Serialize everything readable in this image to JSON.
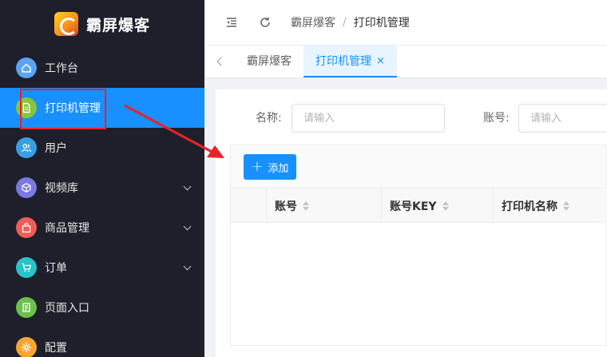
{
  "app": {
    "title": "霸屏爆客"
  },
  "sidebar": {
    "items": [
      {
        "label": "工作台",
        "icon": "home-icon",
        "color": "#5aa3f5",
        "active": false,
        "expandable": false
      },
      {
        "label": "打印机管理",
        "icon": "document-icon",
        "color": "#87c63a",
        "active": true,
        "expandable": false
      },
      {
        "label": "用户",
        "icon": "users-icon",
        "color": "#3a9fe2",
        "active": false,
        "expandable": false
      },
      {
        "label": "视频库",
        "icon": "cube-icon",
        "color": "#7b78e0",
        "active": false,
        "expandable": true
      },
      {
        "label": "商品管理",
        "icon": "bag-icon",
        "color": "#f05d58",
        "active": false,
        "expandable": true
      },
      {
        "label": "订单",
        "icon": "cart-icon",
        "color": "#26c3c7",
        "active": false,
        "expandable": true
      },
      {
        "label": "页面入口",
        "icon": "entry-icon",
        "color": "#6cc04a",
        "active": false,
        "expandable": false
      },
      {
        "label": "配置",
        "icon": "gear-icon",
        "color": "#f7a531",
        "active": false,
        "expandable": false
      }
    ]
  },
  "header": {
    "breadcrumb": [
      "霸屏爆客",
      "打印机管理"
    ],
    "separator": "/"
  },
  "tabs": [
    {
      "label": "霸屏爆客",
      "active": false,
      "closable": false
    },
    {
      "label": "打印机管理",
      "active": true,
      "closable": true,
      "close_glyph": "×"
    }
  ],
  "search": {
    "name_label": "名称:",
    "name_placeholder": "请输入",
    "account_label": "账号:",
    "account_placeholder": "请输入"
  },
  "toolbar": {
    "add_label": "添加",
    "add_glyph": "+"
  },
  "table": {
    "columns": [
      "账号",
      "账号KEY",
      "打印机名称"
    ]
  },
  "colors": {
    "primary": "#1890ff",
    "sidebar_bg": "#1e1f2b",
    "annotation": "#e8222a"
  }
}
